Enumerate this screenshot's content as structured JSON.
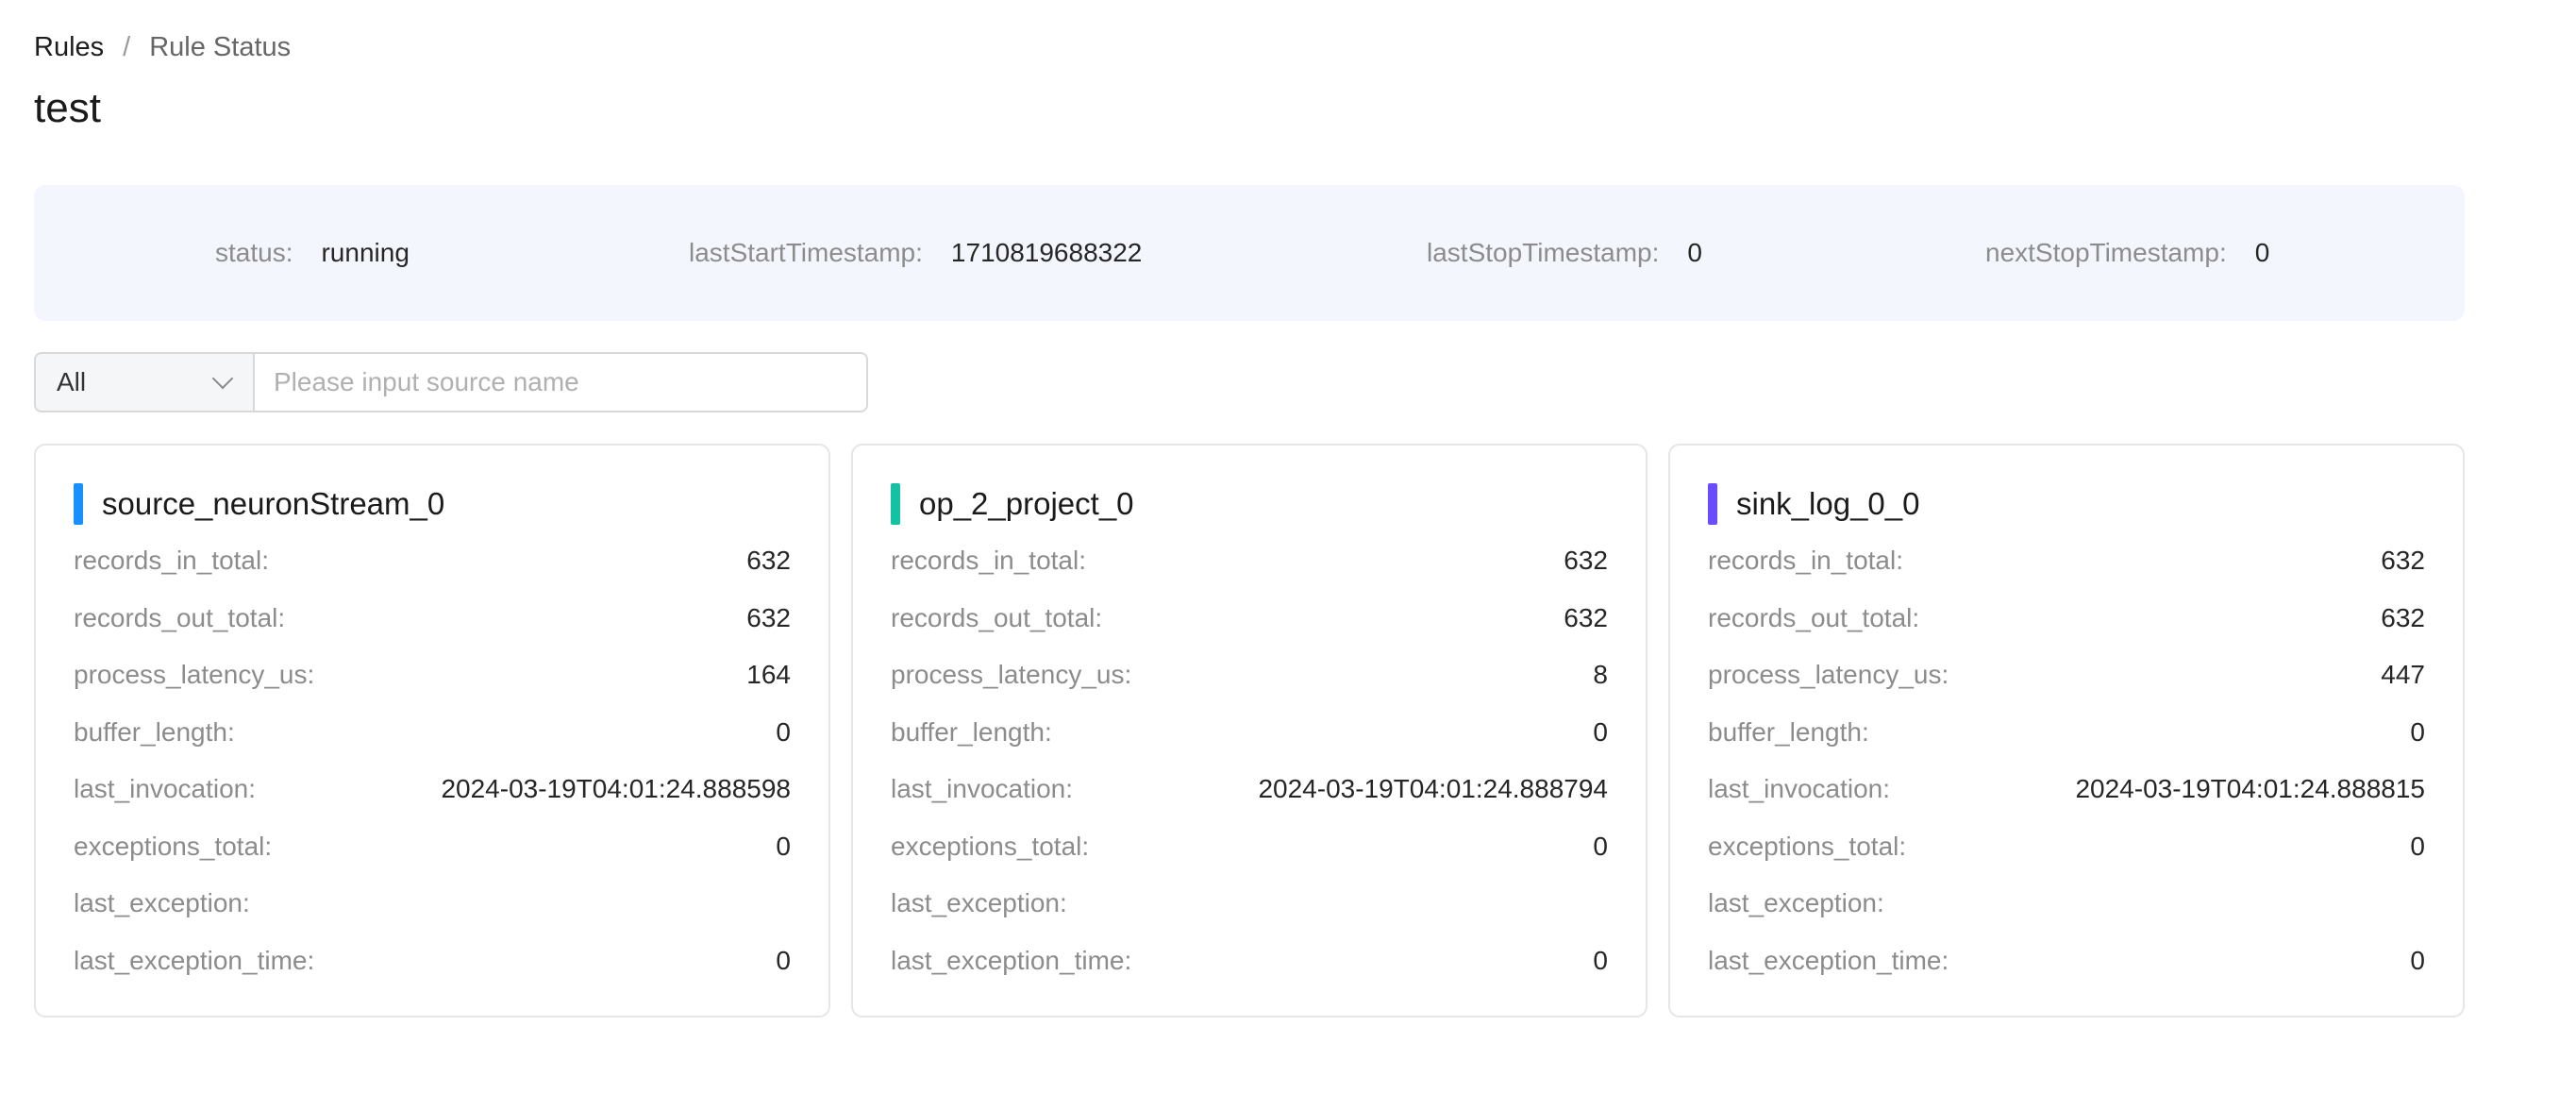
{
  "breadcrumb": {
    "root": "Rules",
    "separator": "/",
    "current": "Rule Status"
  },
  "page": {
    "title": "test"
  },
  "status": {
    "status_label": "status:",
    "status_value": "running",
    "last_start_label": "lastStartTimestamp:",
    "last_start_value": "1710819688322",
    "last_stop_label": "lastStopTimestamp:",
    "last_stop_value": "0",
    "next_stop_label": "nextStopTimestamp:",
    "next_stop_value": "0"
  },
  "filter": {
    "selected": "All",
    "placeholder": "Please input source name"
  },
  "metric_labels": [
    "records_in_total:",
    "records_out_total:",
    "process_latency_us:",
    "buffer_length:",
    "last_invocation:",
    "exceptions_total:",
    "last_exception:",
    "last_exception_time:"
  ],
  "cards": [
    {
      "title": "source_neuronStream_0",
      "accent_color": "#1890ff",
      "values": [
        "632",
        "632",
        "164",
        "0",
        "2024-03-19T04:01:24.888598",
        "0",
        "",
        "0"
      ]
    },
    {
      "title": "op_2_project_0",
      "accent_color": "#13c2a3",
      "values": [
        "632",
        "632",
        "8",
        "0",
        "2024-03-19T04:01:24.888794",
        "0",
        "",
        "0"
      ]
    },
    {
      "title": "sink_log_0_0",
      "accent_color": "#6b4dff",
      "values": [
        "632",
        "632",
        "447",
        "0",
        "2024-03-19T04:01:24.888815",
        "0",
        "",
        "0"
      ]
    }
  ],
  "colors": {
    "status_panel_bg": "#f3f7fd",
    "card_border": "#e6e6e6",
    "label_text": "#8c8c8c"
  }
}
